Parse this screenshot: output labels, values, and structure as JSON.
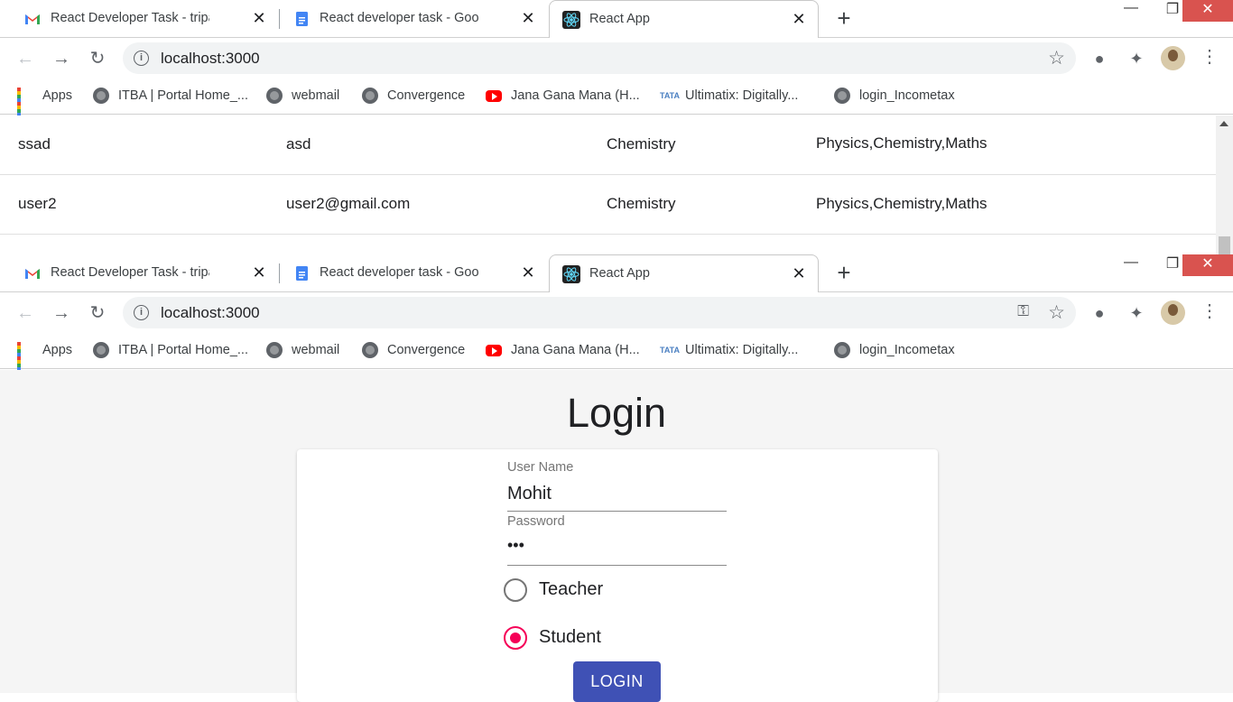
{
  "tabs": [
    {
      "title": "React Developer Task - tripathim",
      "favicon": "gmail-icon"
    },
    {
      "title": "React developer task - Google Dc",
      "favicon": "google-docs-icon"
    },
    {
      "title": "React App",
      "favicon": "react-icon"
    }
  ],
  "address": {
    "url": "localhost:3000"
  },
  "bookmarks": [
    {
      "label": "Apps",
      "icon": "apps-grid-icon"
    },
    {
      "label": "ITBA | Portal Home_...",
      "icon": "globe-icon"
    },
    {
      "label": "webmail",
      "icon": "globe-icon"
    },
    {
      "label": "Convergence",
      "icon": "globe-icon"
    },
    {
      "label": "Jana Gana Mana (H...",
      "icon": "youtube-icon"
    },
    {
      "label": "Ultimatix: Digitally...",
      "icon": "tata-icon"
    },
    {
      "label": "login_Incometax",
      "icon": "globe-icon"
    }
  ],
  "table": {
    "rows": [
      [
        "ssad",
        "asd",
        "Chemistry",
        "Physics,Chemistry,Maths"
      ],
      [
        "user2",
        "user2@gmail.com",
        "Chemistry",
        "Physics,Chemistry,Maths"
      ]
    ]
  },
  "login": {
    "title": "Login",
    "username_label": "User Name",
    "username_value": "Mohit",
    "password_label": "Password",
    "password_value": "•••",
    "role_options": [
      "Teacher",
      "Student"
    ],
    "selected_role": "Student",
    "button_label": "LOGIN"
  },
  "colors": {
    "accent": "#3f51b5",
    "radio_selected": "#f50057",
    "close_button": "#d9534f"
  }
}
